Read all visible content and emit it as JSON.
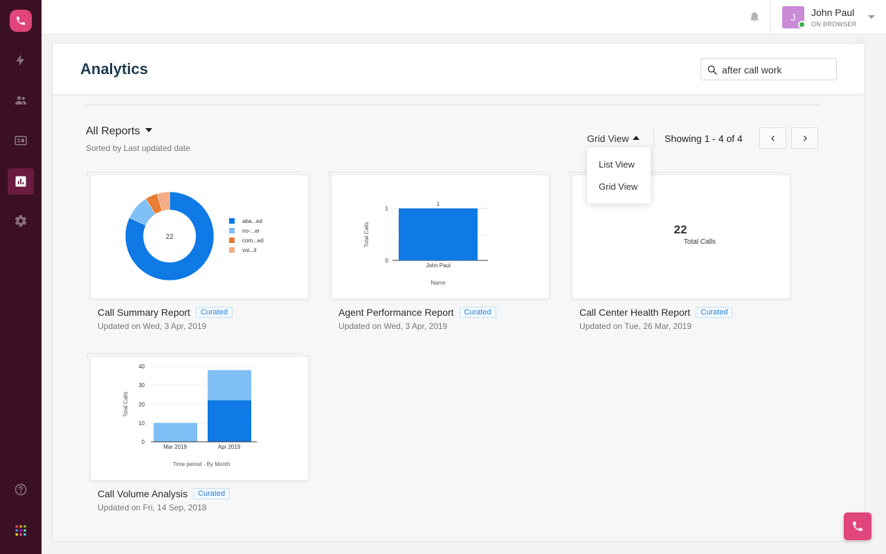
{
  "topbar": {
    "user_name": "John Paul",
    "user_status": "ON BROWSER",
    "avatar_initial": "J"
  },
  "page": {
    "title": "Analytics",
    "search_value": "after call work"
  },
  "toolbar": {
    "reports_filter": "All Reports",
    "sorted_by": "Sorted by Last updated date",
    "view_toggle": "Grid View",
    "showing": "Showing 1 - 4 of 4",
    "view_menu": [
      "List View",
      "Grid View"
    ]
  },
  "cards": [
    {
      "title": "Call Summary Report",
      "badge": "Curated",
      "updated": "Updated on Wed, 3 Apr, 2019"
    },
    {
      "title": "Agent Performance Report",
      "badge": "Curated",
      "updated": "Updated on Wed, 3 Apr, 2019"
    },
    {
      "title": "Call Center Health Report",
      "badge": "Curated",
      "updated": "Updated on Tue, 26 Mar, 2019"
    },
    {
      "title": "Call Volume Analysis",
      "badge": "Curated",
      "updated": "Updated on Fri, 14 Sep, 2018"
    }
  ],
  "chart_data": [
    {
      "type": "pie",
      "center_label": "22",
      "labels": [
        "aba...ed",
        "no-...er",
        "com...ed",
        "voi...il"
      ],
      "values": [
        18,
        2,
        1,
        1
      ],
      "colors": [
        "#0f7ae5",
        "#7fbff5",
        "#ea7d36",
        "#f4ad86"
      ]
    },
    {
      "type": "bar",
      "categories": [
        "John Paul"
      ],
      "values": [
        1
      ],
      "data_labels": [
        "1"
      ],
      "xlabel": "Name",
      "ylabel": "Total Calls",
      "yticks": [
        "0",
        "1"
      ],
      "ylim": [
        0,
        1
      ],
      "color": "#0f7ae5"
    },
    {
      "type": "table",
      "value": "22",
      "label": "Total Calls"
    },
    {
      "type": "bar",
      "stacked": true,
      "categories": [
        "Mar 2019",
        "Apr 2019"
      ],
      "series": [
        {
          "values": [
            0,
            22
          ],
          "color": "#0f7ae5"
        },
        {
          "values": [
            10,
            16
          ],
          "color": "#7fbff5"
        }
      ],
      "xlabel": "Time period - By Month",
      "ylabel": "Total Calls",
      "yticks": [
        "0",
        "10",
        "20",
        "30",
        "40"
      ],
      "ylim": [
        0,
        40
      ]
    }
  ],
  "colors": {
    "sidebar_bg": "#3b1024",
    "brand": "#e0457b",
    "title": "#1d3b4e",
    "badge": "#2b7fd1"
  }
}
